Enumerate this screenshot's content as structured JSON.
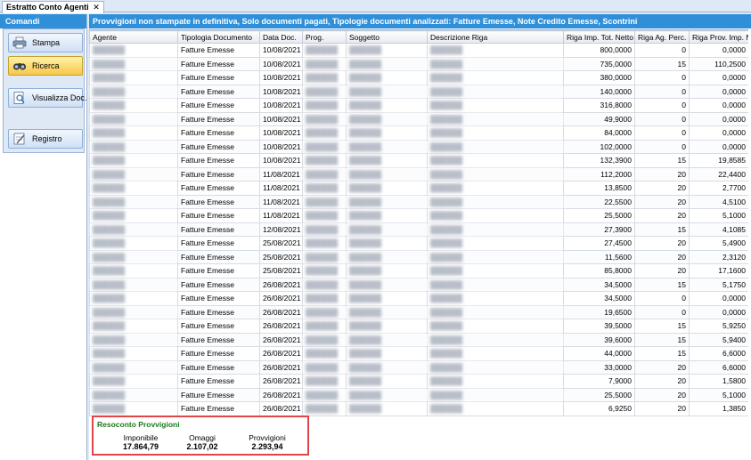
{
  "tab": {
    "label": "Estratto Conto Agenti",
    "close": "✕"
  },
  "sidebar": {
    "header": "Comandi",
    "buttons": [
      {
        "label": "Stampa",
        "icon": "printer-icon"
      },
      {
        "label": "Ricerca",
        "icon": "search-binoculars-icon"
      },
      {
        "label": "Visualizza Doc.",
        "icon": "document-view-icon"
      },
      {
        "label": "Registro",
        "icon": "register-icon"
      }
    ]
  },
  "title": "Provvigioni non stampate in definitiva, Solo documenti pagati, Tipologie documenti analizzati: Fatture Emesse, Note Credito Emesse, Scontrini",
  "table": {
    "columns": [
      "Agente",
      "Tipologia Documento",
      "Data Doc.",
      "Prog.",
      "Soggetto",
      "Descrizione Riga",
      "Riga Imp. Tot. Netto",
      "Riga Ag. Perc.",
      "Riga Prov. Imp. Netto"
    ],
    "rows": [
      [
        "Fatture Emesse",
        "10/08/2021",
        "800,0000",
        "0",
        "0,0000"
      ],
      [
        "Fatture Emesse",
        "10/08/2021",
        "735,0000",
        "15",
        "110,2500"
      ],
      [
        "Fatture Emesse",
        "10/08/2021",
        "380,0000",
        "0",
        "0,0000"
      ],
      [
        "Fatture Emesse",
        "10/08/2021",
        "140,0000",
        "0",
        "0,0000"
      ],
      [
        "Fatture Emesse",
        "10/08/2021",
        "316,8000",
        "0",
        "0,0000"
      ],
      [
        "Fatture Emesse",
        "10/08/2021",
        "49,9000",
        "0",
        "0,0000"
      ],
      [
        "Fatture Emesse",
        "10/08/2021",
        "84,0000",
        "0",
        "0,0000"
      ],
      [
        "Fatture Emesse",
        "10/08/2021",
        "102,0000",
        "0",
        "0,0000"
      ],
      [
        "Fatture Emesse",
        "10/08/2021",
        "132,3900",
        "15",
        "19,8585"
      ],
      [
        "Fatture Emesse",
        "11/08/2021",
        "112,2000",
        "20",
        "22,4400"
      ],
      [
        "Fatture Emesse",
        "11/08/2021",
        "13,8500",
        "20",
        "2,7700"
      ],
      [
        "Fatture Emesse",
        "11/08/2021",
        "22,5500",
        "20",
        "4,5100"
      ],
      [
        "Fatture Emesse",
        "11/08/2021",
        "25,5000",
        "20",
        "5,1000"
      ],
      [
        "Fatture Emesse",
        "12/08/2021",
        "27,3900",
        "15",
        "4,1085"
      ],
      [
        "Fatture Emesse",
        "25/08/2021",
        "27,4500",
        "20",
        "5,4900"
      ],
      [
        "Fatture Emesse",
        "25/08/2021",
        "11,5600",
        "20",
        "2,3120"
      ],
      [
        "Fatture Emesse",
        "25/08/2021",
        "85,8000",
        "20",
        "17,1600"
      ],
      [
        "Fatture Emesse",
        "26/08/2021",
        "34,5000",
        "15",
        "5,1750"
      ],
      [
        "Fatture Emesse",
        "26/08/2021",
        "34,5000",
        "0",
        "0,0000"
      ],
      [
        "Fatture Emesse",
        "26/08/2021",
        "19,6500",
        "0",
        "0,0000"
      ],
      [
        "Fatture Emesse",
        "26/08/2021",
        "39,5000",
        "15",
        "5,9250"
      ],
      [
        "Fatture Emesse",
        "26/08/2021",
        "39,6000",
        "15",
        "5,9400"
      ],
      [
        "Fatture Emesse",
        "26/08/2021",
        "44,0000",
        "15",
        "6,6000"
      ],
      [
        "Fatture Emesse",
        "26/08/2021",
        "33,0000",
        "20",
        "6,6000"
      ],
      [
        "Fatture Emesse",
        "26/08/2021",
        "7,9000",
        "20",
        "1,5800"
      ],
      [
        "Fatture Emesse",
        "26/08/2021",
        "25,5000",
        "20",
        "5,1000"
      ],
      [
        "Fatture Emesse",
        "26/08/2021",
        "6,9250",
        "20",
        "1,3850"
      ]
    ]
  },
  "summary": {
    "title": "Resoconto Provvigioni",
    "items": [
      {
        "label": "Imponibile",
        "value": "17.864,79"
      },
      {
        "label": "Omaggi",
        "value": "2.107,02"
      },
      {
        "label": "Provvigioni",
        "value": "2.293,94"
      }
    ]
  }
}
